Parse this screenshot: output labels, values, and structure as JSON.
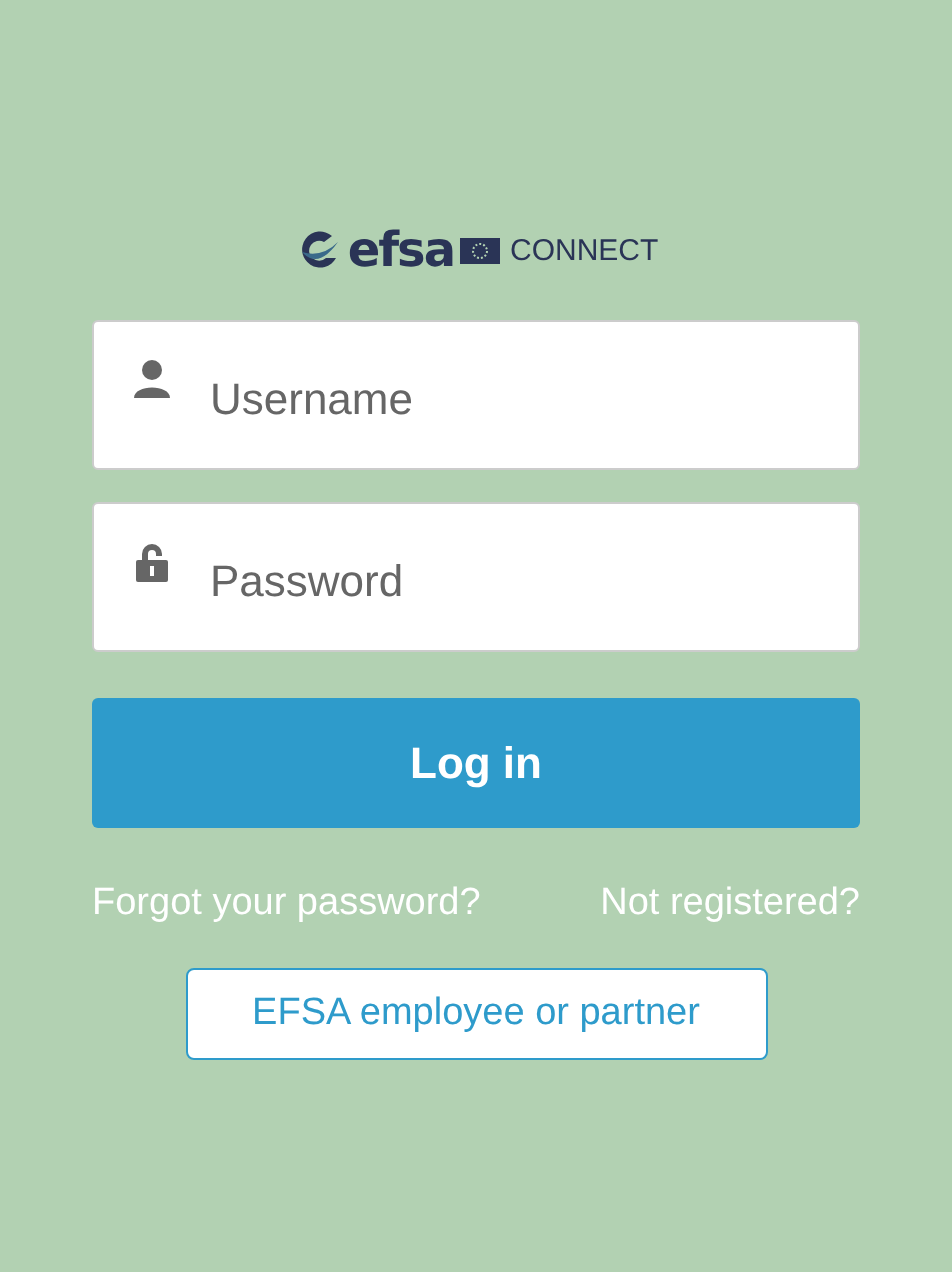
{
  "logo": {
    "brand": "efsa",
    "product": "CONNECT"
  },
  "fields": [
    {
      "kind": "user",
      "placeholder": "Username"
    },
    {
      "kind": "lock",
      "placeholder": "Password"
    }
  ],
  "login_button": "Log in",
  "links": [
    "Forgot your password?",
    "Not registered?"
  ],
  "secondary_button": "EFSA employee or partner"
}
